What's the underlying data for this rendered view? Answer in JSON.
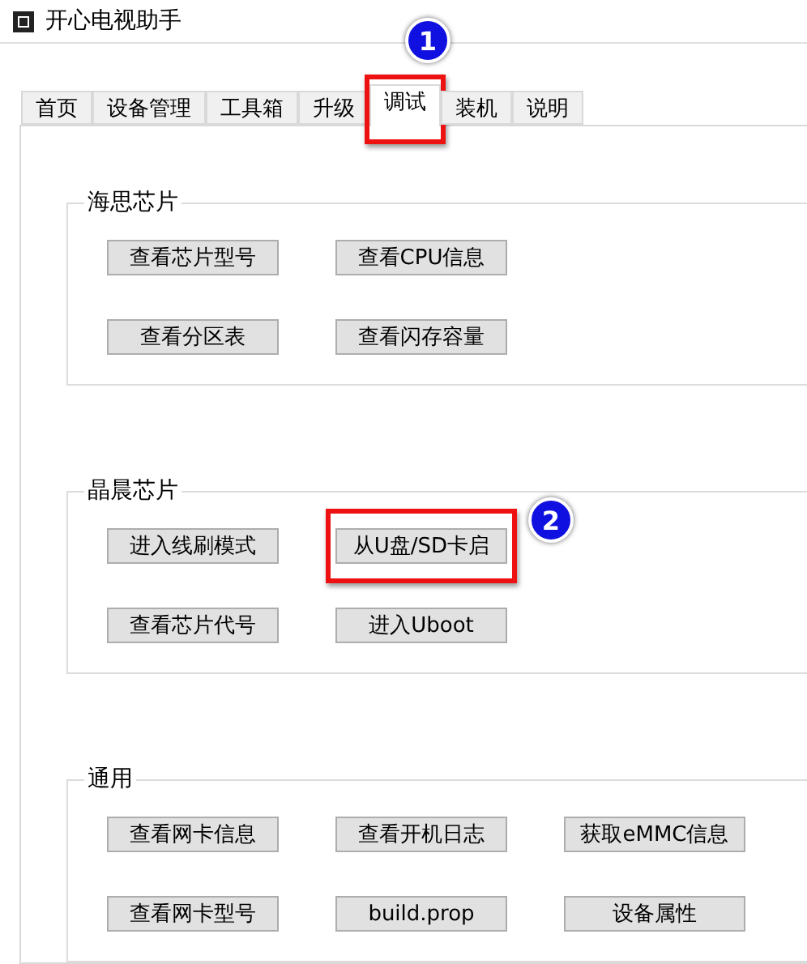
{
  "window": {
    "title": "开心电视助手"
  },
  "tabs": [
    {
      "label": "首页",
      "selected": false,
      "highlighted": false
    },
    {
      "label": "设备管理",
      "selected": false,
      "highlighted": false
    },
    {
      "label": "工具箱",
      "selected": false,
      "highlighted": false
    },
    {
      "label": "升级",
      "selected": false,
      "highlighted": false
    },
    {
      "label": "调试",
      "selected": true,
      "highlighted": true,
      "marker": "1"
    },
    {
      "label": "装机",
      "selected": false,
      "highlighted": false
    },
    {
      "label": "说明",
      "selected": false,
      "highlighted": false
    }
  ],
  "groups": [
    {
      "title": "海思芯片",
      "buttons": [
        {
          "label": "查看芯片型号",
          "highlighted": false
        },
        {
          "label": "查看CPU信息",
          "highlighted": false
        },
        {
          "label": "查看分区表",
          "highlighted": false
        },
        {
          "label": "查看闪存容量",
          "highlighted": false
        }
      ]
    },
    {
      "title": "晶晨芯片",
      "buttons": [
        {
          "label": "进入线刷模式",
          "highlighted": false
        },
        {
          "label": "从U盘/SD卡启",
          "highlighted": true,
          "marker": "2"
        },
        {
          "label": "查看芯片代号",
          "highlighted": false
        },
        {
          "label": "进入Uboot",
          "highlighted": false
        }
      ]
    },
    {
      "title": "通用",
      "buttons": [
        {
          "label": "查看网卡信息",
          "highlighted": false
        },
        {
          "label": "查看开机日志",
          "highlighted": false
        },
        {
          "label": "获取eMMC信息",
          "highlighted": false
        },
        {
          "label": "查看网卡型号",
          "highlighted": false
        },
        {
          "label": "build.prop",
          "highlighted": false
        },
        {
          "label": "设备属性",
          "highlighted": false
        }
      ]
    }
  ]
}
